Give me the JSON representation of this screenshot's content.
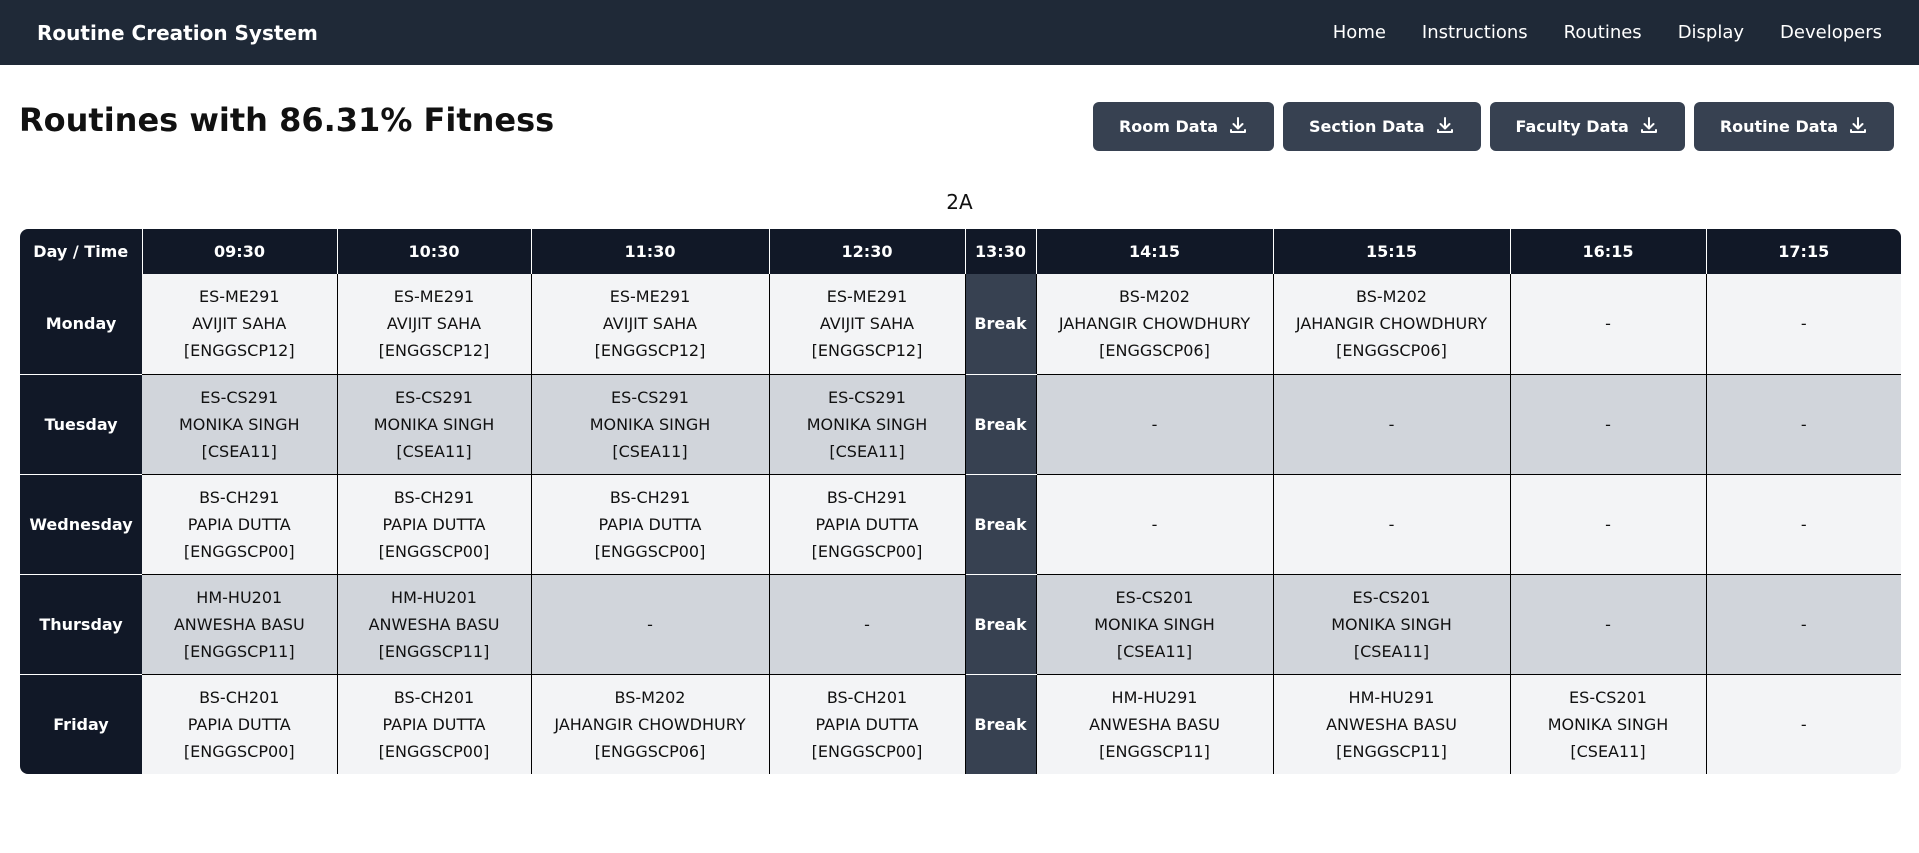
{
  "nav": {
    "brand": "Routine Creation System",
    "links": [
      "Home",
      "Instructions",
      "Routines",
      "Display",
      "Developers"
    ]
  },
  "page": {
    "title": "Routines with 86.31% Fitness",
    "buttons": [
      "Room Data",
      "Section Data",
      "Faculty Data",
      "Routine Data"
    ],
    "section": "2A"
  },
  "table": {
    "headers": [
      "Day / Time",
      "09:30",
      "10:30",
      "11:30",
      "12:30",
      "13:30",
      "14:15",
      "15:15",
      "16:15",
      "17:15"
    ],
    "break_label": "Break",
    "rows": [
      {
        "day": "Monday",
        "cells": [
          [
            "ES-ME291",
            "AVIJIT SAHA",
            "[ENGGSCP12]"
          ],
          [
            "ES-ME291",
            "AVIJIT SAHA",
            "[ENGGSCP12]"
          ],
          [
            "ES-ME291",
            "AVIJIT SAHA",
            "[ENGGSCP12]"
          ],
          [
            "ES-ME291",
            "AVIJIT SAHA",
            "[ENGGSCP12]"
          ],
          [
            "BS-M202",
            "JAHANGIR CHOWDHURY",
            "[ENGGSCP06]"
          ],
          [
            "BS-M202",
            "JAHANGIR CHOWDHURY",
            "[ENGGSCP06]"
          ],
          [
            "-"
          ],
          [
            "-"
          ]
        ]
      },
      {
        "day": "Tuesday",
        "cells": [
          [
            "ES-CS291",
            "MONIKA SINGH",
            "[CSEA11]"
          ],
          [
            "ES-CS291",
            "MONIKA SINGH",
            "[CSEA11]"
          ],
          [
            "ES-CS291",
            "MONIKA SINGH",
            "[CSEA11]"
          ],
          [
            "ES-CS291",
            "MONIKA SINGH",
            "[CSEA11]"
          ],
          [
            "-"
          ],
          [
            "-"
          ],
          [
            "-"
          ],
          [
            "-"
          ]
        ]
      },
      {
        "day": "Wednesday",
        "cells": [
          [
            "BS-CH291",
            "PAPIA DUTTA",
            "[ENGGSCP00]"
          ],
          [
            "BS-CH291",
            "PAPIA DUTTA",
            "[ENGGSCP00]"
          ],
          [
            "BS-CH291",
            "PAPIA DUTTA",
            "[ENGGSCP00]"
          ],
          [
            "BS-CH291",
            "PAPIA DUTTA",
            "[ENGGSCP00]"
          ],
          [
            "-"
          ],
          [
            "-"
          ],
          [
            "-"
          ],
          [
            "-"
          ]
        ]
      },
      {
        "day": "Thursday",
        "cells": [
          [
            "HM-HU201",
            "ANWESHA BASU",
            "[ENGGSCP11]"
          ],
          [
            "HM-HU201",
            "ANWESHA BASU",
            "[ENGGSCP11]"
          ],
          [
            "-"
          ],
          [
            "-"
          ],
          [
            "ES-CS201",
            "MONIKA SINGH",
            "[CSEA11]"
          ],
          [
            "ES-CS201",
            "MONIKA SINGH",
            "[CSEA11]"
          ],
          [
            "-"
          ],
          [
            "-"
          ]
        ]
      },
      {
        "day": "Friday",
        "cells": [
          [
            "BS-CH201",
            "PAPIA DUTTA",
            "[ENGGSCP00]"
          ],
          [
            "BS-CH201",
            "PAPIA DUTTA",
            "[ENGGSCP00]"
          ],
          [
            "BS-M202",
            "JAHANGIR CHOWDHURY",
            "[ENGGSCP06]"
          ],
          [
            "BS-CH201",
            "PAPIA DUTTA",
            "[ENGGSCP00]"
          ],
          [
            "HM-HU291",
            "ANWESHA BASU",
            "[ENGGSCP11]"
          ],
          [
            "HM-HU291",
            "ANWESHA BASU",
            "[ENGGSCP11]"
          ],
          [
            "ES-CS201",
            "MONIKA SINGH",
            "[CSEA11]"
          ],
          [
            "-"
          ]
        ]
      }
    ]
  }
}
